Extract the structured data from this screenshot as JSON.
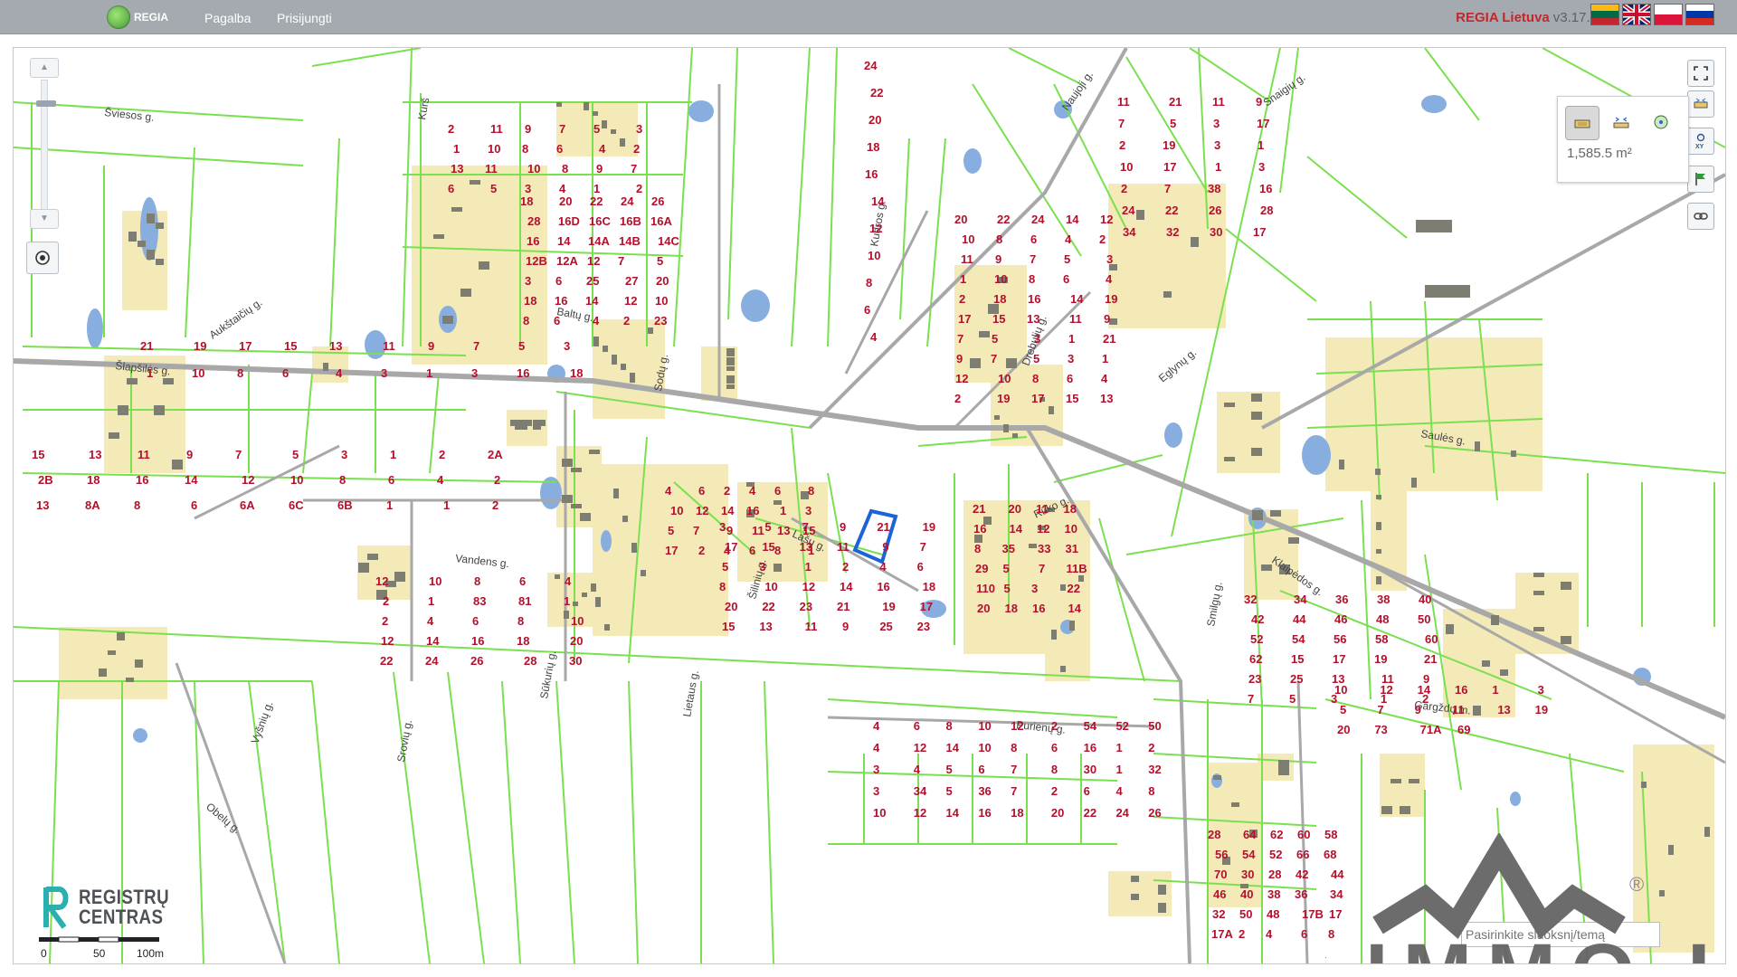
{
  "topbar": {
    "logo_text": "REGIA",
    "nav": [
      "Pagalba",
      "Prisijungti"
    ],
    "brand_name": "REGIA Lietuva",
    "brand_version": "v3.17.1",
    "languages": [
      "Lietuvių",
      "English",
      "Polski",
      "Русский"
    ]
  },
  "colors": {
    "parcel_border": "#7be04f",
    "built_area": "#f4eab8",
    "road": "#a8a8a8",
    "building": "#7d7d72",
    "water": "#88aee0",
    "parcel_number": "#b1112c",
    "selected_parcel": "#1d63d8"
  },
  "measure": {
    "value": "1,585.5 m²"
  },
  "zoom": {
    "in_icon": "triangle-up",
    "out_icon": "triangle-down"
  },
  "scale": {
    "labels": [
      "0",
      "50",
      "100m"
    ]
  },
  "branding": {
    "registru_line1": "REGISTRŲ",
    "registru_line2": "CENTRAS",
    "watermark": "IMMO.LT"
  },
  "search": {
    "placeholder": "Pasirinkite sluoksnį/temą"
  },
  "streets": [
    {
      "name": "Šviesos g."
    },
    {
      "name": "Kurš"
    },
    {
      "name": "Kudros g."
    },
    {
      "name": "Naujoji g."
    },
    {
      "name": "Snaigių g."
    },
    {
      "name": "Aukštaičių g."
    },
    {
      "name": "Baltų g."
    },
    {
      "name": "Šlapšilės g."
    },
    {
      "name": "Sodų g."
    },
    {
      "name": "Drebulių g."
    },
    {
      "name": "Eglynų g."
    },
    {
      "name": "Saulės g."
    },
    {
      "name": "Klaipėdos g."
    },
    {
      "name": "Rūko g."
    },
    {
      "name": "Lašų g."
    },
    {
      "name": "Vandens g."
    },
    {
      "name": "Šilinių g."
    },
    {
      "name": "Smilgų g."
    },
    {
      "name": "Purienų g."
    },
    {
      "name": "Gargždų m."
    },
    {
      "name": "Vyšnių g."
    },
    {
      "name": "Sūkurių g."
    },
    {
      "name": "Lietaus g."
    },
    {
      "name": "Srovių g."
    },
    {
      "name": "Obelų g."
    }
  ],
  "parcels": [
    "24",
    "22",
    "20",
    "18",
    "16",
    "14",
    "12",
    "10",
    "8",
    "6",
    "4",
    "2",
    "11",
    "9",
    "7",
    "5",
    "3",
    "1",
    "10",
    "8",
    "6",
    "4",
    "2",
    "13",
    "11",
    "10",
    "8",
    "9",
    "7",
    "6",
    "5",
    "3",
    "4",
    "1",
    "2",
    "18",
    "20",
    "22",
    "24",
    "26",
    "28",
    "16D",
    "16C",
    "16B",
    "16A",
    "16",
    "14",
    "14A",
    "14B",
    "14C",
    "12B",
    "12A",
    "12",
    "7",
    "5",
    "3",
    "6",
    "25",
    "27",
    "20",
    "18",
    "16",
    "14",
    "12",
    "10",
    "8",
    "6",
    "4",
    "2",
    "23",
    "21",
    "19",
    "17",
    "15",
    "13",
    "11",
    "9",
    "7",
    "5",
    "3",
    "1",
    "10",
    "8",
    "6",
    "4",
    "3",
    "1",
    "3",
    "16",
    "18",
    "20",
    "22",
    "24",
    "14",
    "12",
    "10",
    "8",
    "6",
    "4",
    "2",
    "11",
    "9",
    "7",
    "5",
    "3",
    "1",
    "10",
    "8",
    "6",
    "4",
    "2",
    "18",
    "16",
    "14",
    "19",
    "17",
    "15",
    "13",
    "11",
    "9",
    "7",
    "5",
    "3",
    "1",
    "21",
    "9",
    "7",
    "5",
    "3",
    "1",
    "12",
    "10",
    "8",
    "6",
    "4",
    "2",
    "19",
    "17",
    "15",
    "13",
    "11",
    "21",
    "11",
    "9",
    "7",
    "5",
    "3",
    "17",
    "2",
    "19",
    "3",
    "1",
    "10",
    "17",
    "1",
    "3",
    "2",
    "7",
    "38",
    "16",
    "24",
    "22",
    "26",
    "28",
    "34",
    "32",
    "30",
    "17",
    "15",
    "13",
    "11",
    "9",
    "7",
    "5",
    "3",
    "1",
    "2",
    "2A",
    "2B",
    "18",
    "16",
    "14",
    "12",
    "10",
    "8",
    "6",
    "4",
    "2",
    "13",
    "8A",
    "8",
    "6",
    "6A",
    "6C",
    "6B",
    "1",
    "1",
    "2",
    "4",
    "6",
    "2",
    "4",
    "6",
    "8",
    "10",
    "12",
    "14",
    "16",
    "1",
    "3",
    "5",
    "7",
    "9",
    "11",
    "13",
    "15",
    "17",
    "2",
    "4",
    "6",
    "8",
    "1",
    "3",
    "5",
    "7",
    "9",
    "21",
    "19",
    "17",
    "15",
    "13",
    "11",
    "9",
    "7",
    "5",
    "3",
    "1",
    "2",
    "4",
    "6",
    "8",
    "10",
    "12",
    "14",
    "16",
    "18",
    "20",
    "22",
    "23",
    "21",
    "19",
    "17",
    "15",
    "13",
    "11",
    "9",
    "25",
    "23",
    "21",
    "20",
    "11",
    "18",
    "16",
    "14",
    "12",
    "10",
    "8",
    "35",
    "33",
    "31",
    "29",
    "5",
    "7",
    "11B",
    "110",
    "5",
    "3",
    "22",
    "20",
    "18",
    "16",
    "14",
    "12",
    "10",
    "8",
    "6",
    "4",
    "2",
    "1",
    "83",
    "81",
    "1",
    "2",
    "4",
    "6",
    "8",
    "10",
    "12",
    "14",
    "16",
    "18",
    "20",
    "22",
    "24",
    "26",
    "28",
    "30",
    "32",
    "34",
    "36",
    "38",
    "40",
    "42",
    "44",
    "46",
    "48",
    "50",
    "52",
    "54",
    "56",
    "58",
    "60",
    "62",
    "15",
    "17",
    "19",
    "21",
    "23",
    "25",
    "13",
    "11",
    "9",
    "7",
    "5",
    "3",
    "1",
    "2",
    "4",
    "6",
    "8",
    "10",
    "12",
    "2",
    "54",
    "52",
    "50",
    "4",
    "12",
    "14",
    "10",
    "8",
    "6",
    "16",
    "1",
    "2",
    "3",
    "4",
    "5",
    "6",
    "7",
    "8",
    "30",
    "1",
    "32",
    "3",
    "34",
    "5",
    "36",
    "7",
    "2",
    "6",
    "4",
    "8",
    "10",
    "12",
    "14",
    "16",
    "18",
    "20",
    "22",
    "24",
    "26",
    "28",
    "64",
    "62",
    "60",
    "58",
    "56",
    "54",
    "52",
    "66",
    "68",
    "70",
    "30",
    "28",
    "42",
    "44",
    "46",
    "40",
    "38",
    "36",
    "34",
    "32",
    "50",
    "48",
    "17B",
    "17",
    "17A",
    "2",
    "4",
    "6",
    "8",
    "10",
    "12",
    "14",
    "16",
    "1",
    "3",
    "5",
    "7",
    "9",
    "11",
    "13",
    "19",
    "20",
    "73",
    "71A",
    "69"
  ]
}
